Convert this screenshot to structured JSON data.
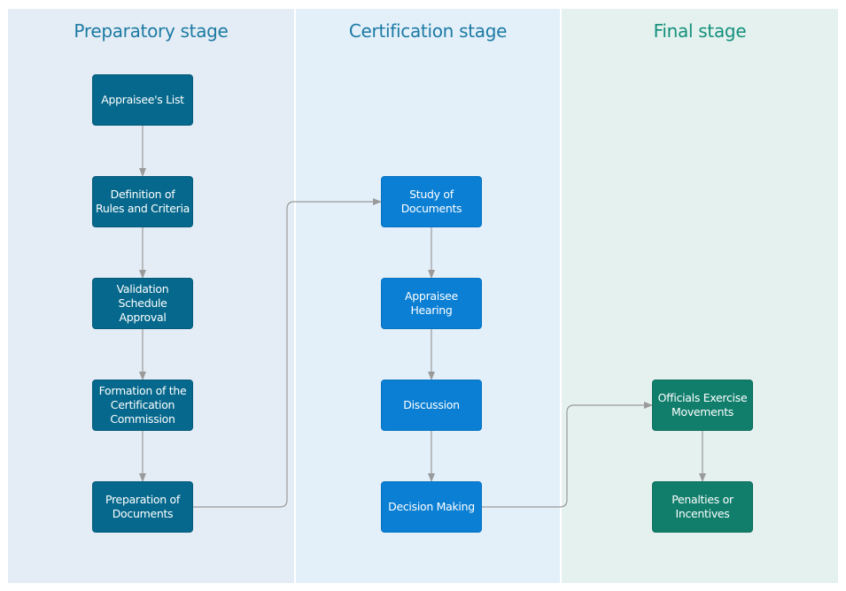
{
  "lanes": [
    {
      "id": "prep",
      "title": "Preparatory stage",
      "color": "#1c7aa3"
    },
    {
      "id": "cert",
      "title": "Certification stage",
      "color": "#1c7aa3"
    },
    {
      "id": "final",
      "title": "Final stage",
      "color": "#14907c"
    }
  ],
  "nodes": {
    "appraisees_list": "Appraisee's List",
    "definition_rules": "Definition of Rules and Criteria",
    "validation_schedule": "Validation Schedule Approval",
    "formation_commission": "Formation of the Certification Commission",
    "preparation_documents": "Preparation of Documents",
    "study_documents": "Study of Documents",
    "appraisee_hearing": "Appraisee Hearing",
    "discussion": "Discussion",
    "decision_making": "Decision Making",
    "officials_exercise": "Officials Exercise Movements",
    "penalties_incentives": "Penalties or Incentives"
  },
  "edges": [
    [
      "appraisees_list",
      "definition_rules"
    ],
    [
      "definition_rules",
      "validation_schedule"
    ],
    [
      "validation_schedule",
      "formation_commission"
    ],
    [
      "formation_commission",
      "preparation_documents"
    ],
    [
      "preparation_documents",
      "study_documents"
    ],
    [
      "study_documents",
      "appraisee_hearing"
    ],
    [
      "appraisee_hearing",
      "discussion"
    ],
    [
      "discussion",
      "decision_making"
    ],
    [
      "decision_making",
      "officials_exercise"
    ],
    [
      "officials_exercise",
      "penalties_incentives"
    ]
  ],
  "colors": {
    "prep_node": "#05688c",
    "cert_node": "#0a7fd4",
    "final_node": "#117e6c",
    "connector": "#9a9a9a"
  }
}
